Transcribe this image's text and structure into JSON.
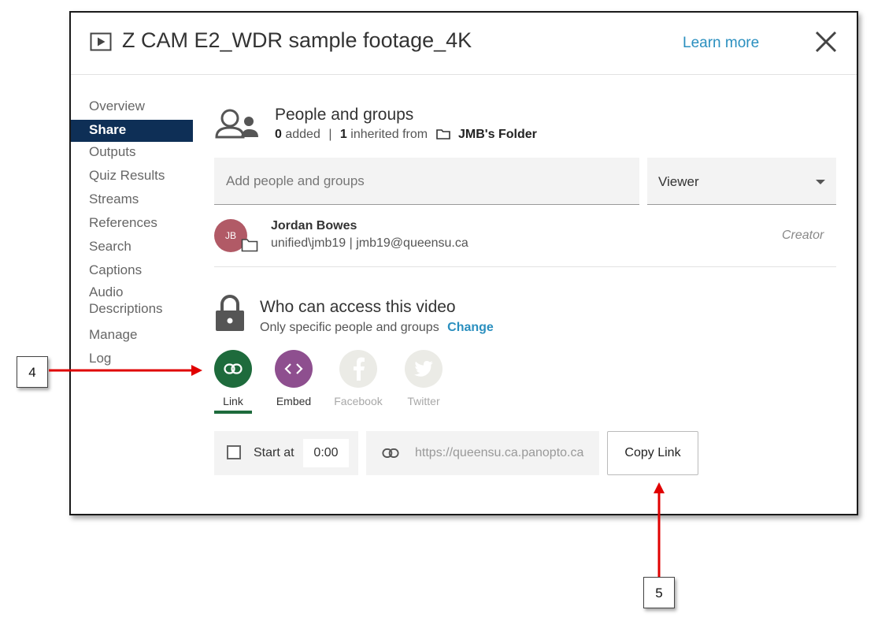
{
  "header": {
    "title": "Z CAM E2_WDR sample footage_4K",
    "learn_more": "Learn more"
  },
  "sidebar": {
    "items": [
      {
        "label": "Overview"
      },
      {
        "label": "Share",
        "active": true
      },
      {
        "label": "Outputs"
      },
      {
        "label": "Quiz Results"
      },
      {
        "label": "Streams"
      },
      {
        "label": "References"
      },
      {
        "label": "Search"
      },
      {
        "label": "Captions"
      },
      {
        "label": "Audio Descriptions"
      },
      {
        "label": "Manage"
      },
      {
        "label": "Log"
      }
    ]
  },
  "people": {
    "heading": "People and groups",
    "added_count": "0",
    "added_label": "added",
    "separator": "|",
    "inherited_count": "1",
    "inherited_label": "inherited from",
    "folder_name": "JMB's Folder",
    "input_placeholder": "Add people and groups",
    "role_select": "Viewer",
    "entry": {
      "initials": "JB",
      "name": "Jordan Bowes",
      "detail": "unified\\jmb19 | jmb19@queensu.ca",
      "role": "Creator"
    }
  },
  "access": {
    "heading": "Who can access this video",
    "description": "Only specific people and groups",
    "change_link": "Change"
  },
  "share_options": [
    {
      "label": "Link",
      "color": "#1e6b3c",
      "active": true
    },
    {
      "label": "Embed",
      "color": "#8e4f8f",
      "active": false
    },
    {
      "label": "Facebook",
      "color": "#ebebe6",
      "active": false
    },
    {
      "label": "Twitter",
      "color": "#ebebe6",
      "active": false
    }
  ],
  "link_bar": {
    "start_at_label": "Start at",
    "start_time": "0:00",
    "url": "https://queensu.ca.panopto.ca",
    "copy_button": "Copy Link"
  },
  "callouts": {
    "four": "4",
    "five": "5"
  },
  "colors": {
    "accent": "#2a8fbf",
    "sidebar_active": "#0e2f56",
    "link_green": "#1e6b3c",
    "embed_purple": "#8e4f8f",
    "avatar": "#b15a66",
    "annotation_red": "#e00000"
  }
}
